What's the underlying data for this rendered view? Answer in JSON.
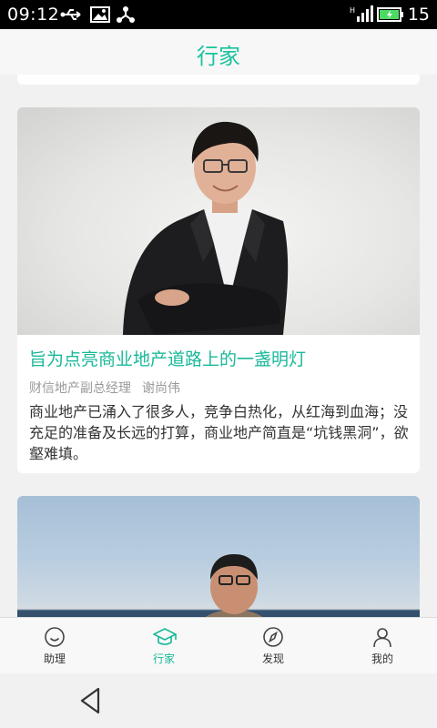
{
  "status_bar": {
    "time": "09:12",
    "battery_level": "15",
    "icons": [
      "usb-icon",
      "image-icon",
      "share-icon",
      "signal-icon",
      "battery-charging-icon"
    ]
  },
  "header": {
    "title": "行家"
  },
  "cards": [
    {
      "title": "旨为点亮商业地产道路上的一盏明灯",
      "position": "财信地产副总经理",
      "author": "谢尚伟",
      "summary": "商业地产已涌入了很多人，竞争白热化，从红海到血海；没充足的准备及长远的打算，商业地产简直是“坑钱黑洞”，欲壑难填。"
    }
  ],
  "bottom_nav": {
    "items": [
      {
        "label": "助理",
        "icon": "smiley-icon",
        "active": false
      },
      {
        "label": "行家",
        "icon": "graduation-cap-icon",
        "active": true
      },
      {
        "label": "发现",
        "icon": "compass-icon",
        "active": false
      },
      {
        "label": "我的",
        "icon": "user-icon",
        "active": false
      }
    ]
  },
  "colors": {
    "accent": "#19b89a",
    "status_bar": "#000000",
    "background": "#f1f1f1"
  }
}
